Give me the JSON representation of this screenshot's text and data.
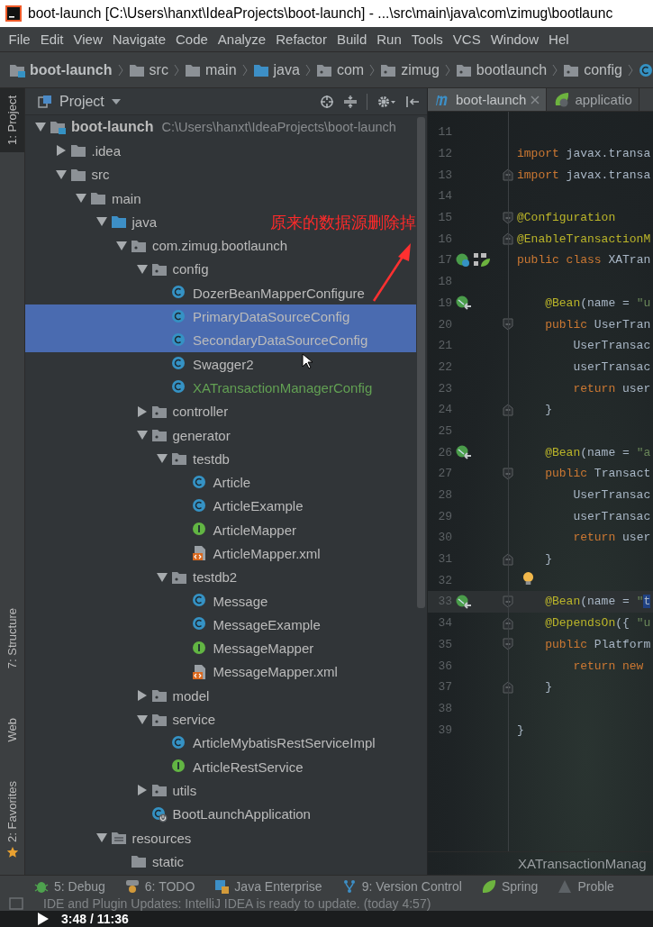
{
  "window": {
    "title": "boot-launch [C:\\Users\\hanxt\\IdeaProjects\\boot-launch] - ...\\src\\main\\java\\com\\zimug\\bootlaunc"
  },
  "menu": [
    "File",
    "Edit",
    "View",
    "Navigate",
    "Code",
    "Analyze",
    "Refactor",
    "Build",
    "Run",
    "Tools",
    "VCS",
    "Window",
    "Hel"
  ],
  "nav_bar": [
    {
      "label": "boot-launch",
      "kind": "module"
    },
    {
      "label": "src",
      "kind": "folder"
    },
    {
      "label": "main",
      "kind": "folder"
    },
    {
      "label": "java",
      "kind": "source"
    },
    {
      "label": "com",
      "kind": "package"
    },
    {
      "label": "zimug",
      "kind": "package"
    },
    {
      "label": "bootlaunch",
      "kind": "package"
    },
    {
      "label": "config",
      "kind": "package"
    }
  ],
  "left_strip": [
    {
      "label": "1: Project",
      "selected": true,
      "kind": "project"
    },
    {
      "label": "7: Structure",
      "selected": false,
      "kind": "structure"
    },
    {
      "label": "Web",
      "selected": false,
      "kind": "web"
    },
    {
      "label": "2: Favorites",
      "selected": false,
      "kind": "favorites"
    }
  ],
  "project": {
    "title": "Project",
    "tree": [
      {
        "label": "boot-launch",
        "path": "C:\\Users\\hanxt\\IdeaProjects\\boot-launch",
        "kind": "module",
        "selected": false,
        "expanded": true,
        "children": [
          {
            "label": ".idea",
            "kind": "folder",
            "selected": false,
            "expanded": false
          },
          {
            "label": "src",
            "kind": "folder",
            "selected": false,
            "expanded": true,
            "children": [
              {
                "label": "main",
                "kind": "folder",
                "selected": false,
                "expanded": true,
                "children": [
                  {
                    "label": "java",
                    "kind": "source",
                    "selected": false,
                    "expanded": true,
                    "children": [
                      {
                        "label": "com.zimug.bootlaunch",
                        "kind": "package",
                        "selected": false,
                        "expanded": true,
                        "children": [
                          {
                            "label": "config",
                            "kind": "package",
                            "selected": false,
                            "expanded": true,
                            "children": [
                              {
                                "label": "DozerBeanMapperConfigure",
                                "kind": "class",
                                "selected": false,
                                "added": false
                              },
                              {
                                "label": "PrimaryDataSourceConfig",
                                "kind": "class",
                                "selected": true,
                                "added": false
                              },
                              {
                                "label": "SecondaryDataSourceConfig",
                                "kind": "class",
                                "selected": true,
                                "added": false
                              },
                              {
                                "label": "Swagger2",
                                "kind": "class",
                                "selected": false,
                                "added": false
                              },
                              {
                                "label": "XATransactionManagerConfig",
                                "kind": "class",
                                "selected": false,
                                "added": true
                              }
                            ]
                          },
                          {
                            "label": "controller",
                            "kind": "package",
                            "selected": false,
                            "expanded": false
                          },
                          {
                            "label": "generator",
                            "kind": "package",
                            "selected": false,
                            "expanded": true,
                            "children": [
                              {
                                "label": "testdb",
                                "kind": "package",
                                "selected": false,
                                "expanded": true,
                                "children": [
                                  {
                                    "label": "Article",
                                    "kind": "class",
                                    "selected": false,
                                    "added": false
                                  },
                                  {
                                    "label": "ArticleExample",
                                    "kind": "class",
                                    "selected": false,
                                    "added": false
                                  },
                                  {
                                    "label": "ArticleMapper",
                                    "kind": "interface",
                                    "selected": false,
                                    "added": false
                                  },
                                  {
                                    "label": "ArticleMapper.xml",
                                    "kind": "xml",
                                    "selected": false,
                                    "added": false
                                  }
                                ]
                              },
                              {
                                "label": "testdb2",
                                "kind": "package",
                                "selected": false,
                                "expanded": true,
                                "children": [
                                  {
                                    "label": "Message",
                                    "kind": "class",
                                    "selected": false,
                                    "added": false
                                  },
                                  {
                                    "label": "MessageExample",
                                    "kind": "class",
                                    "selected": false,
                                    "added": false
                                  },
                                  {
                                    "label": "MessageMapper",
                                    "kind": "interface",
                                    "selected": false,
                                    "added": false
                                  },
                                  {
                                    "label": "MessageMapper.xml",
                                    "kind": "xml",
                                    "selected": false,
                                    "added": false
                                  }
                                ]
                              }
                            ]
                          },
                          {
                            "label": "model",
                            "kind": "package",
                            "selected": false,
                            "expanded": false
                          },
                          {
                            "label": "service",
                            "kind": "package",
                            "selected": false,
                            "expanded": true,
                            "children": [
                              {
                                "label": "ArticleMybatisRestServiceImpl",
                                "kind": "class",
                                "selected": false,
                                "added": false
                              },
                              {
                                "label": "ArticleRestService",
                                "kind": "interface",
                                "selected": false,
                                "added": false
                              }
                            ]
                          },
                          {
                            "label": "utils",
                            "kind": "package",
                            "selected": false,
                            "expanded": false
                          },
                          {
                            "label": "BootLaunchApplication",
                            "kind": "boot",
                            "selected": false,
                            "added": false
                          }
                        ]
                      }
                    ]
                  },
                  {
                    "label": "resources",
                    "kind": "resources",
                    "selected": false,
                    "expanded": true,
                    "children": [
                      {
                        "label": "static",
                        "kind": "folder",
                        "selected": false
                      }
                    ]
                  }
                ]
              }
            ]
          }
        ]
      }
    ]
  },
  "editor": {
    "tabs": [
      {
        "label": "boot-launch",
        "kind": "maven",
        "selected": true,
        "closable": true
      },
      {
        "label": "applicatio",
        "kind": "spring",
        "selected": false,
        "closable": false
      }
    ],
    "lines": [
      {
        "number": "11",
        "current": false
      },
      {
        "number": "12",
        "current": false,
        "tokens": [
          {
            "text": "import ",
            "kind": "keyword"
          },
          {
            "text": "javax.transa",
            "kind": "plain"
          }
        ]
      },
      {
        "number": "13",
        "current": false,
        "fold": {
          "kind": "end"
        },
        "tokens": [
          {
            "text": "import ",
            "kind": "keyword"
          },
          {
            "text": "javax.transa",
            "kind": "plain"
          }
        ]
      },
      {
        "number": "14",
        "current": false
      },
      {
        "number": "15",
        "current": false,
        "fold": {
          "kind": "start"
        },
        "tokens": [
          {
            "text": "@Configuration",
            "kind": "annotation"
          }
        ]
      },
      {
        "number": "16",
        "current": false,
        "fold": {
          "kind": "end"
        },
        "tokens": [
          {
            "text": "@EnableTransactionM",
            "kind": "annotation"
          }
        ]
      },
      {
        "number": "17",
        "current": false,
        "gutter": {
          "kind": "class"
        },
        "tokens": [
          {
            "text": "public class ",
            "kind": "keyword"
          },
          {
            "text": "XATran",
            "kind": "plain"
          }
        ]
      },
      {
        "number": "18",
        "current": false
      },
      {
        "number": "19",
        "current": false,
        "gutter": {
          "kind": "bean"
        },
        "tokens": [
          {
            "text": "    @Bean",
            "kind": "annotation"
          },
          {
            "text": "(name = ",
            "kind": "plain"
          },
          {
            "text": "\"u",
            "kind": "string"
          }
        ]
      },
      {
        "number": "20",
        "current": false,
        "fold": {
          "kind": "start"
        },
        "tokens": [
          {
            "text": "    public ",
            "kind": "keyword"
          },
          {
            "text": "UserTran",
            "kind": "plain"
          }
        ]
      },
      {
        "number": "21",
        "current": false,
        "tokens": [
          {
            "text": "        UserTransac",
            "kind": "plain"
          }
        ]
      },
      {
        "number": "22",
        "current": false,
        "tokens": [
          {
            "text": "        userTransac",
            "kind": "plain"
          }
        ]
      },
      {
        "number": "23",
        "current": false,
        "tokens": [
          {
            "text": "        return ",
            "kind": "keyword"
          },
          {
            "text": "user",
            "kind": "plain"
          }
        ]
      },
      {
        "number": "24",
        "current": false,
        "fold": {
          "kind": "end"
        },
        "tokens": [
          {
            "text": "    }",
            "kind": "plain"
          }
        ]
      },
      {
        "number": "25",
        "current": false
      },
      {
        "number": "26",
        "current": false,
        "gutter": {
          "kind": "bean"
        },
        "tokens": [
          {
            "text": "    @Bean",
            "kind": "annotation"
          },
          {
            "text": "(name = ",
            "kind": "plain"
          },
          {
            "text": "\"a",
            "kind": "string"
          }
        ]
      },
      {
        "number": "27",
        "current": false,
        "fold": {
          "kind": "start"
        },
        "tokens": [
          {
            "text": "    public ",
            "kind": "keyword"
          },
          {
            "text": "Transact",
            "kind": "plain"
          }
        ]
      },
      {
        "number": "28",
        "current": false,
        "tokens": [
          {
            "text": "        UserTransac",
            "kind": "plain"
          }
        ]
      },
      {
        "number": "29",
        "current": false,
        "tokens": [
          {
            "text": "        userTransac",
            "kind": "plain"
          }
        ]
      },
      {
        "number": "30",
        "current": false,
        "tokens": [
          {
            "text": "        return ",
            "kind": "keyword"
          },
          {
            "text": "user",
            "kind": "plain"
          }
        ]
      },
      {
        "number": "31",
        "current": false,
        "fold": {
          "kind": "end"
        },
        "tokens": [
          {
            "text": "    }",
            "kind": "plain"
          }
        ]
      },
      {
        "number": "32",
        "current": false,
        "marker": {
          "kind": "bulb"
        }
      },
      {
        "number": "33",
        "current": true,
        "gutter": {
          "kind": "bean"
        },
        "fold": {
          "kind": "start"
        },
        "tokens": [
          {
            "text": "    @Bean",
            "kind": "annotation"
          },
          {
            "text": "(name = ",
            "kind": "plain"
          },
          {
            "text": "\"",
            "kind": "string"
          },
          {
            "text": "t",
            "kind": "selection"
          }
        ]
      },
      {
        "number": "34",
        "current": false,
        "fold": {
          "kind": "end"
        },
        "tokens": [
          {
            "text": "    @DependsOn",
            "kind": "annotation"
          },
          {
            "text": "({ ",
            "kind": "plain"
          },
          {
            "text": "\"u",
            "kind": "string"
          }
        ]
      },
      {
        "number": "35",
        "current": false,
        "fold": {
          "kind": "start"
        },
        "tokens": [
          {
            "text": "    public ",
            "kind": "keyword"
          },
          {
            "text": "Platform",
            "kind": "plain"
          }
        ]
      },
      {
        "number": "36",
        "current": false,
        "tokens": [
          {
            "text": "        return new",
            "kind": "keyword"
          }
        ]
      },
      {
        "number": "37",
        "current": false,
        "fold": {
          "kind": "end"
        },
        "tokens": [
          {
            "text": "    }",
            "kind": "plain"
          }
        ]
      },
      {
        "number": "38",
        "current": false
      },
      {
        "number": "39",
        "current": false,
        "tokens": [
          {
            "text": "}",
            "kind": "plain"
          }
        ]
      }
    ],
    "breadcrumb": "XATransactionManag"
  },
  "annotation": {
    "text": "原来的数据源删除掉"
  },
  "tool_windows": [
    {
      "label": "5: Debug",
      "kind": "debug"
    },
    {
      "label": "6: TODO",
      "kind": "todo"
    },
    {
      "label": "Java Enterprise",
      "kind": "enterprise"
    },
    {
      "label": "9: Version Control",
      "kind": "vcs"
    },
    {
      "label": "Spring",
      "kind": "spring"
    },
    {
      "label": "Proble",
      "kind": "problems"
    }
  ],
  "status_bar": {
    "message": "IDE and Plugin Updates: IntelliJ IDEA is ready to update. (today 4:57)"
  },
  "player": {
    "time": "3:48 / 11:36"
  }
}
